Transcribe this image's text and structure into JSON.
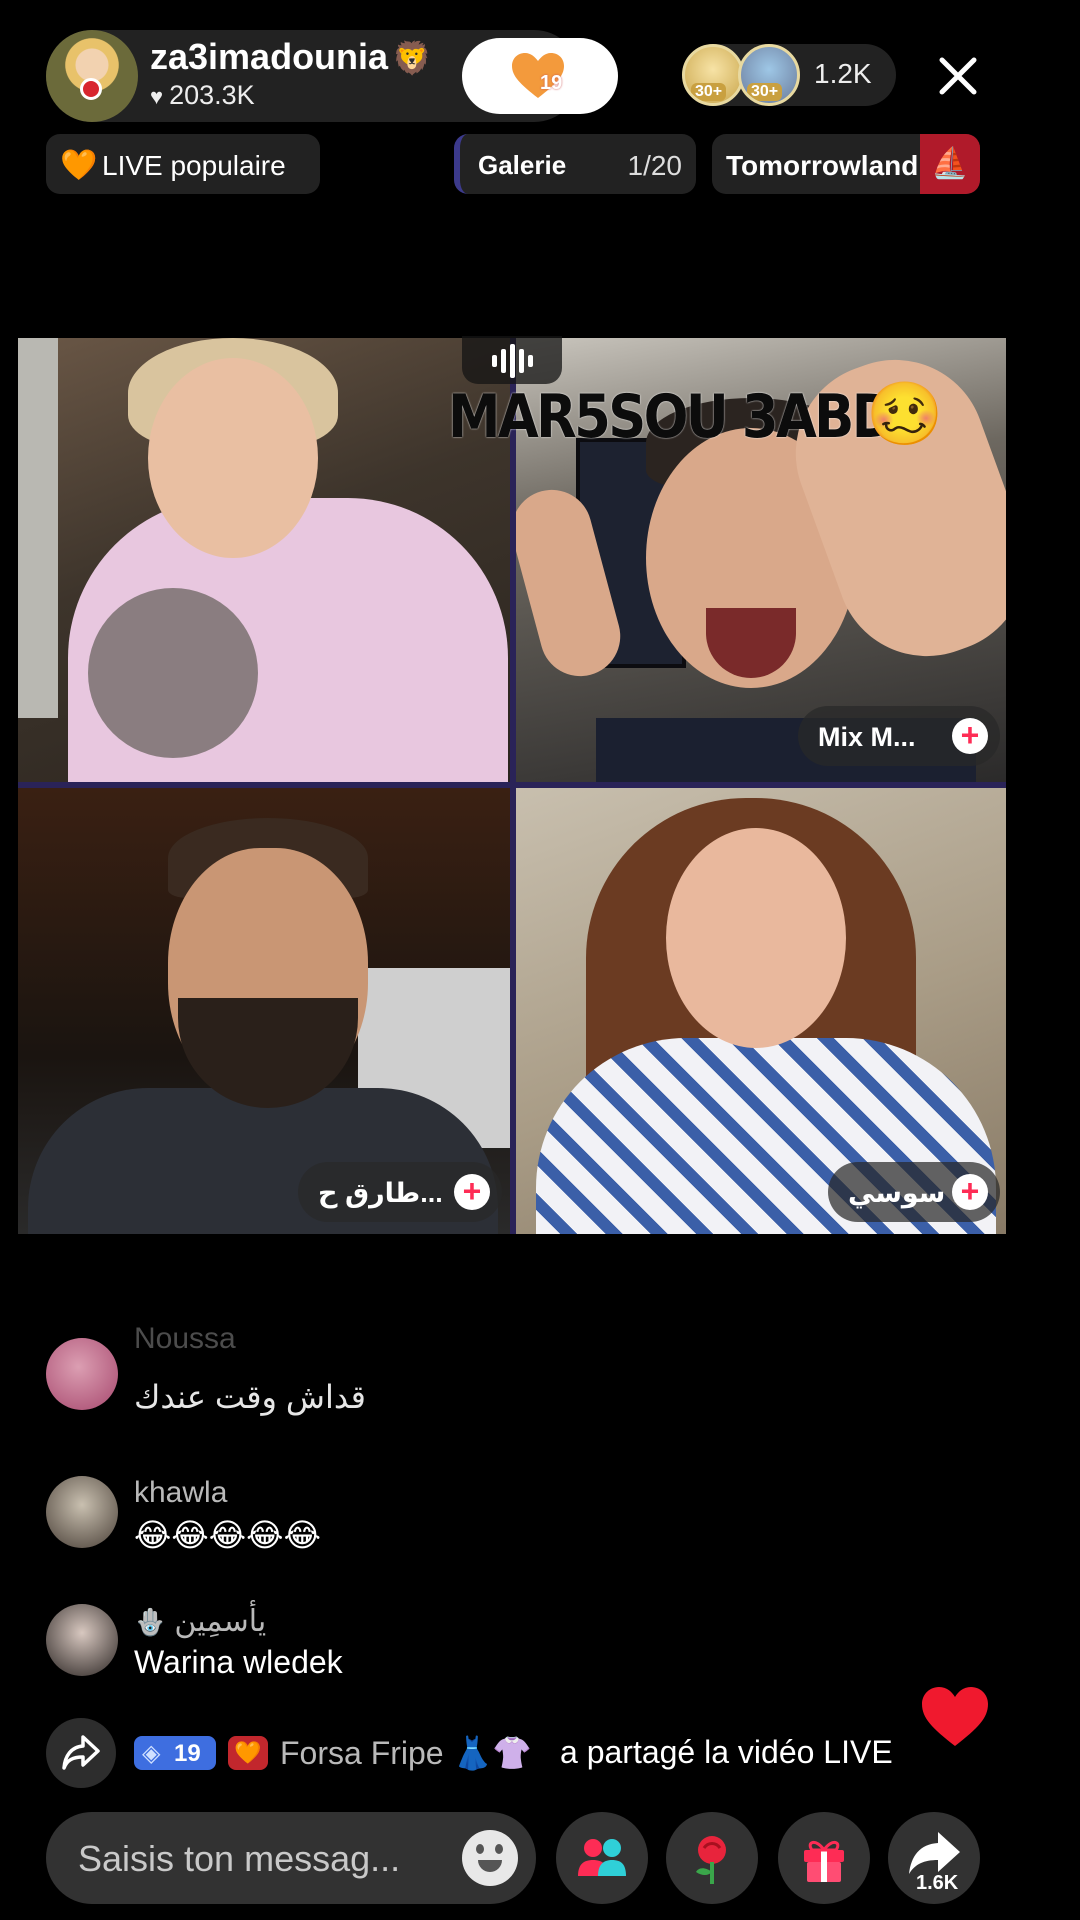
{
  "host": {
    "username": "za3imadounia",
    "name_emoji": "🦁",
    "likes": "203.3K",
    "follow_badge_count": "19"
  },
  "viewers": {
    "ranks": [
      "30+",
      "30+"
    ],
    "count": "1.2K"
  },
  "badges": {
    "popular_icon": "🧡",
    "popular_label": "LIVE populaire",
    "gallery_label": "Galerie",
    "gallery_count": "1/20",
    "tomorrowland_label": "Tomorrowland",
    "tomorrowland_icon": "⛵"
  },
  "video_grid": {
    "overlay_title": "MAR5SOU 3ABD",
    "overlay_emoji": "🥴",
    "tiles": [
      {
        "id": "host",
        "tag": ""
      },
      {
        "id": "guest-1",
        "tag": "Mix  M..."
      },
      {
        "id": "guest-2",
        "tag": "طارق ح..."
      },
      {
        "id": "guest-3",
        "tag": "سوسي ..."
      }
    ]
  },
  "comments": [
    {
      "name": "Noussa",
      "text": "قداش وقت عندك"
    },
    {
      "name": "khawla",
      "text": "😂😂😂😂😂"
    },
    {
      "name": "يأسمِين",
      "name_icon": "🪬",
      "text": "Warina wledek"
    }
  ],
  "share_notice": {
    "level": "19",
    "user": "Forsa Fripe 👗👚",
    "text": "a partagé la vidéo LIVE"
  },
  "composer": {
    "placeholder": "Saisis ton messag..."
  },
  "actions": {
    "share_count": "1.6K"
  },
  "colors": {
    "accent_red": "#fe2c55",
    "grid_divider": "#2a2358",
    "level_badge": "#3e6ee0"
  }
}
